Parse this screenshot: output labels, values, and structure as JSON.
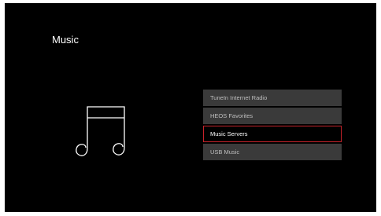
{
  "screen": {
    "title": "Music",
    "icon": "music-note-icon"
  },
  "menu": {
    "items": [
      {
        "label": "TuneIn Internet Radio",
        "selected": false
      },
      {
        "label": "HEOS Favorites",
        "selected": false
      },
      {
        "label": "Music Servers",
        "selected": true
      },
      {
        "label": "USB Music",
        "selected": false
      }
    ]
  },
  "colors": {
    "background": "#000000",
    "item_background": "#3a3a3a",
    "selection_border": "#c7222a"
  }
}
